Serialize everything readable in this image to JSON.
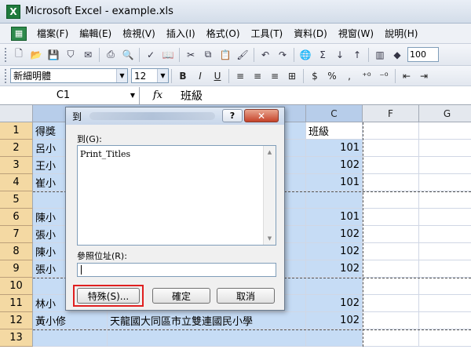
{
  "window": {
    "title": "Microsoft Excel - example.xls"
  },
  "menu": {
    "items": [
      "檔案(F)",
      "編輯(E)",
      "檢視(V)",
      "插入(I)",
      "格式(O)",
      "工具(T)",
      "資料(D)",
      "視窗(W)",
      "說明(H)"
    ]
  },
  "toolbar": {
    "icons": [
      "new-icon",
      "open-icon",
      "save-icon",
      "permission-icon",
      "print-icon",
      "print-preview-icon",
      "spelling-icon",
      "research-icon",
      "cut-icon",
      "copy-icon",
      "paste-icon",
      "format-painter-icon",
      "undo-icon",
      "redo-icon",
      "hyperlink-icon",
      "autosum-icon",
      "sort-ascending-icon",
      "sort-descending-icon",
      "chart-wizard-icon",
      "drawing-icon"
    ],
    "zoom": "100"
  },
  "format_toolbar": {
    "font": "新細明體",
    "size": "12",
    "bold": "B",
    "italic": "I",
    "underline": "U",
    "currency": "$",
    "percent": "%",
    "comma": ","
  },
  "formula_bar": {
    "name_box": "C1",
    "fx": "fx",
    "value": "班級"
  },
  "grid": {
    "columns": [
      "",
      "C",
      "F",
      "G"
    ],
    "rows": [
      "1",
      "2",
      "3",
      "4",
      "5",
      "6",
      "7",
      "8",
      "9",
      "10",
      "11",
      "12",
      "13"
    ],
    "colA": [
      "得獎",
      "呂小",
      "王小",
      "崔小",
      "",
      "陳小",
      "張小",
      "陳小",
      "張小",
      "",
      "林小",
      "黃小修",
      ""
    ],
    "colB_row12": "天龍國大同區市立雙連國民小學",
    "colC": [
      "班級",
      "101",
      "102",
      "101",
      "",
      "101",
      "102",
      "102",
      "102",
      "",
      "102",
      "102",
      ""
    ]
  },
  "dialog": {
    "title": "到",
    "help": "?",
    "close": "✕",
    "goto_label": "到(G):",
    "list_item": "Print_Titles",
    "reference_label": "參照位址(R):",
    "reference_value": "",
    "special_button": "特殊(S)...",
    "ok_button": "確定",
    "cancel_button": "取消"
  }
}
